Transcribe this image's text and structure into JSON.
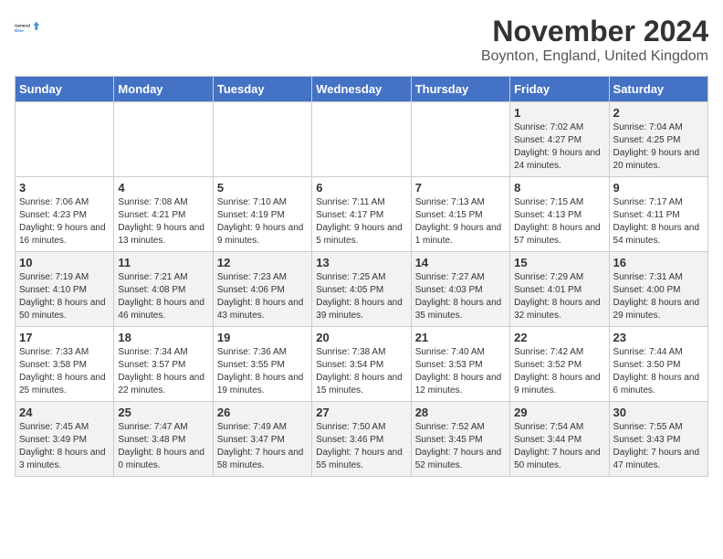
{
  "logo": {
    "text_general": "General",
    "text_blue": "Blue"
  },
  "title": "November 2024",
  "subtitle": "Boynton, England, United Kingdom",
  "headers": [
    "Sunday",
    "Monday",
    "Tuesday",
    "Wednesday",
    "Thursday",
    "Friday",
    "Saturday"
  ],
  "weeks": [
    [
      {
        "day": "",
        "info": ""
      },
      {
        "day": "",
        "info": ""
      },
      {
        "day": "",
        "info": ""
      },
      {
        "day": "",
        "info": ""
      },
      {
        "day": "",
        "info": ""
      },
      {
        "day": "1",
        "info": "Sunrise: 7:02 AM\nSunset: 4:27 PM\nDaylight: 9 hours and 24 minutes."
      },
      {
        "day": "2",
        "info": "Sunrise: 7:04 AM\nSunset: 4:25 PM\nDaylight: 9 hours and 20 minutes."
      }
    ],
    [
      {
        "day": "3",
        "info": "Sunrise: 7:06 AM\nSunset: 4:23 PM\nDaylight: 9 hours and 16 minutes."
      },
      {
        "day": "4",
        "info": "Sunrise: 7:08 AM\nSunset: 4:21 PM\nDaylight: 9 hours and 13 minutes."
      },
      {
        "day": "5",
        "info": "Sunrise: 7:10 AM\nSunset: 4:19 PM\nDaylight: 9 hours and 9 minutes."
      },
      {
        "day": "6",
        "info": "Sunrise: 7:11 AM\nSunset: 4:17 PM\nDaylight: 9 hours and 5 minutes."
      },
      {
        "day": "7",
        "info": "Sunrise: 7:13 AM\nSunset: 4:15 PM\nDaylight: 9 hours and 1 minute."
      },
      {
        "day": "8",
        "info": "Sunrise: 7:15 AM\nSunset: 4:13 PM\nDaylight: 8 hours and 57 minutes."
      },
      {
        "day": "9",
        "info": "Sunrise: 7:17 AM\nSunset: 4:11 PM\nDaylight: 8 hours and 54 minutes."
      }
    ],
    [
      {
        "day": "10",
        "info": "Sunrise: 7:19 AM\nSunset: 4:10 PM\nDaylight: 8 hours and 50 minutes."
      },
      {
        "day": "11",
        "info": "Sunrise: 7:21 AM\nSunset: 4:08 PM\nDaylight: 8 hours and 46 minutes."
      },
      {
        "day": "12",
        "info": "Sunrise: 7:23 AM\nSunset: 4:06 PM\nDaylight: 8 hours and 43 minutes."
      },
      {
        "day": "13",
        "info": "Sunrise: 7:25 AM\nSunset: 4:05 PM\nDaylight: 8 hours and 39 minutes."
      },
      {
        "day": "14",
        "info": "Sunrise: 7:27 AM\nSunset: 4:03 PM\nDaylight: 8 hours and 35 minutes."
      },
      {
        "day": "15",
        "info": "Sunrise: 7:29 AM\nSunset: 4:01 PM\nDaylight: 8 hours and 32 minutes."
      },
      {
        "day": "16",
        "info": "Sunrise: 7:31 AM\nSunset: 4:00 PM\nDaylight: 8 hours and 29 minutes."
      }
    ],
    [
      {
        "day": "17",
        "info": "Sunrise: 7:33 AM\nSunset: 3:58 PM\nDaylight: 8 hours and 25 minutes."
      },
      {
        "day": "18",
        "info": "Sunrise: 7:34 AM\nSunset: 3:57 PM\nDaylight: 8 hours and 22 minutes."
      },
      {
        "day": "19",
        "info": "Sunrise: 7:36 AM\nSunset: 3:55 PM\nDaylight: 8 hours and 19 minutes."
      },
      {
        "day": "20",
        "info": "Sunrise: 7:38 AM\nSunset: 3:54 PM\nDaylight: 8 hours and 15 minutes."
      },
      {
        "day": "21",
        "info": "Sunrise: 7:40 AM\nSunset: 3:53 PM\nDaylight: 8 hours and 12 minutes."
      },
      {
        "day": "22",
        "info": "Sunrise: 7:42 AM\nSunset: 3:52 PM\nDaylight: 8 hours and 9 minutes."
      },
      {
        "day": "23",
        "info": "Sunrise: 7:44 AM\nSunset: 3:50 PM\nDaylight: 8 hours and 6 minutes."
      }
    ],
    [
      {
        "day": "24",
        "info": "Sunrise: 7:45 AM\nSunset: 3:49 PM\nDaylight: 8 hours and 3 minutes."
      },
      {
        "day": "25",
        "info": "Sunrise: 7:47 AM\nSunset: 3:48 PM\nDaylight: 8 hours and 0 minutes."
      },
      {
        "day": "26",
        "info": "Sunrise: 7:49 AM\nSunset: 3:47 PM\nDaylight: 7 hours and 58 minutes."
      },
      {
        "day": "27",
        "info": "Sunrise: 7:50 AM\nSunset: 3:46 PM\nDaylight: 7 hours and 55 minutes."
      },
      {
        "day": "28",
        "info": "Sunrise: 7:52 AM\nSunset: 3:45 PM\nDaylight: 7 hours and 52 minutes."
      },
      {
        "day": "29",
        "info": "Sunrise: 7:54 AM\nSunset: 3:44 PM\nDaylight: 7 hours and 50 minutes."
      },
      {
        "day": "30",
        "info": "Sunrise: 7:55 AM\nSunset: 3:43 PM\nDaylight: 7 hours and 47 minutes."
      }
    ]
  ]
}
